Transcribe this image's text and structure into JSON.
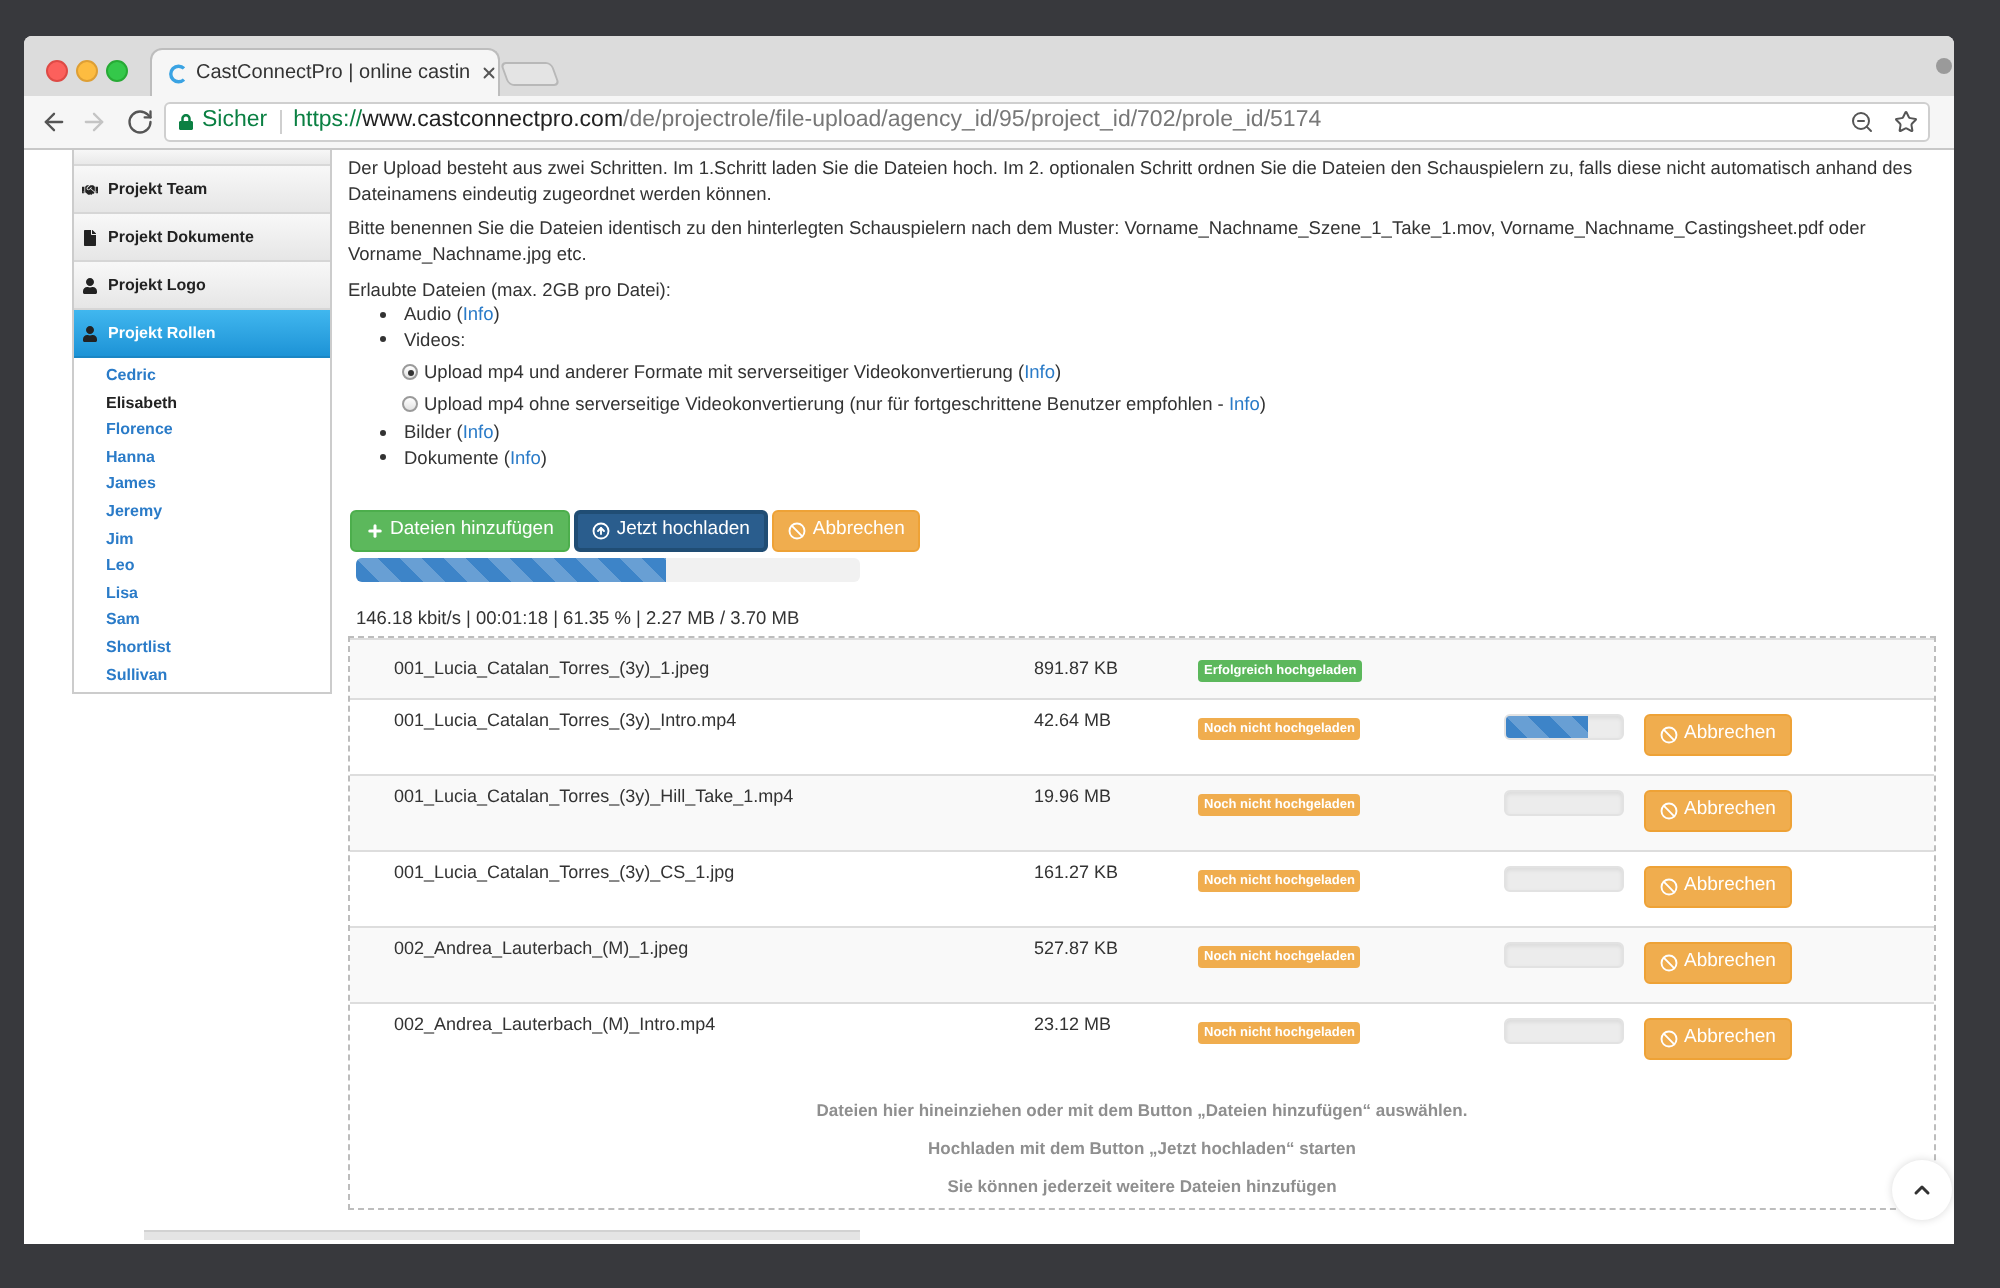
{
  "browser": {
    "tab": {
      "title": "CastConnectPro | online castin",
      "selected": true
    },
    "nav": [
      {
        "kind": "back",
        "disabled": false
      },
      {
        "kind": "forward",
        "disabled": true
      },
      {
        "kind": "reload",
        "disabled": false
      }
    ],
    "address": {
      "security": "Sicher",
      "scheme": "https://",
      "host": "www.castconnectpro.com",
      "path": "/de/projectrole/file-upload/agency_id/95/project_id/702/prole_id/5174"
    }
  },
  "sidebar": {
    "menu": [
      {
        "label": "Projekt Team",
        "selected": false
      },
      {
        "label": "Projekt Dokumente",
        "selected": false
      },
      {
        "label": "Projekt Logo",
        "selected": false
      },
      {
        "label": "Projekt Rollen",
        "selected": true
      }
    ],
    "roles": [
      {
        "label": "Cedric",
        "selected": false
      },
      {
        "label": "Elisabeth",
        "selected": true
      },
      {
        "label": "Florence",
        "selected": false
      },
      {
        "label": "Hanna",
        "selected": false
      },
      {
        "label": "James",
        "selected": false
      },
      {
        "label": "Jeremy",
        "selected": false
      },
      {
        "label": "Jim",
        "selected": false
      },
      {
        "label": "Leo",
        "selected": false
      },
      {
        "label": "Lisa",
        "selected": false
      },
      {
        "label": "Sam",
        "selected": false
      },
      {
        "label": "Shortlist",
        "selected": false
      },
      {
        "label": "Sullivan",
        "selected": false
      }
    ]
  },
  "intro": [
    "Der Upload besteht aus zwei Schritten. Im 1.Schritt laden Sie die Dateien hoch. Im 2. optionalen Schritt ordnen Sie die Dateien den Schauspielern zu, falls diese nicht automatisch anhand des Dateinamens eindeutig zugeordnet werden können.",
    "Bitte benennen Sie die Dateien identisch zu den hinterlegten Schauspielern nach dem Muster: Vorname_Nachname_Szene_1_Take_1.mov, Vorname_Nachname_Castingsheet.pdf oder Vorname_Nachname.jpg etc."
  ],
  "allowed_files": {
    "heading": "Erlaubte Dateien (max. 2GB pro Datei):",
    "items": [
      {
        "text": "Audio (",
        "link": "Info",
        "text_after": ")"
      },
      {
        "text": "Videos:",
        "options": [
          {
            "text": "Upload mp4 und anderer Formate mit serverseitiger Videokonvertierung (",
            "link": "Info",
            "text_after": ")",
            "selected": true
          },
          {
            "text": "Upload mp4 ohne serverseitige Videokonvertierung (nur für fortgeschrittene Benutzer empfohlen - ",
            "link": "Info",
            "text_after": ")",
            "selected": false
          }
        ]
      },
      {
        "text": "Bilder (",
        "link": "Info",
        "text_after": ")"
      },
      {
        "text": "Dokumente (",
        "link": "Info",
        "text_after": ")"
      }
    ]
  },
  "buttons": [
    {
      "label": "Dateien hinzufügen",
      "kind": "add",
      "focused": false
    },
    {
      "label": "Jetzt hochladen",
      "kind": "upload",
      "focused": true
    },
    {
      "label": "Abbrechen",
      "kind": "cancel",
      "focused": false
    }
  ],
  "upload_progress": {
    "level": 0.6135
  },
  "upload_stats": "146.18 kbit/s | 00:01:18 | 61.35 % | 2.27 MB / 3.70 MB",
  "files": [
    {
      "name": "001_Lucia_Catalan_Torres_(3y)_1.jpeg",
      "size": "891.87 KB",
      "status": {
        "label": "Erfolgreich hochgeladen",
        "kind": "success"
      }
    },
    {
      "name": "001_Lucia_Catalan_Torres_(3y)_Intro.mp4",
      "size": "42.64 MB",
      "status": {
        "label": "Noch nicht hochgeladen",
        "kind": "pending"
      },
      "level": 0.71,
      "cancel": "Abbrechen"
    },
    {
      "name": "001_Lucia_Catalan_Torres_(3y)_Hill_Take_1.mp4",
      "size": "19.96 MB",
      "status": {
        "label": "Noch nicht hochgeladen",
        "kind": "pending"
      },
      "cancel": "Abbrechen"
    },
    {
      "name": "001_Lucia_Catalan_Torres_(3y)_CS_1.jpg",
      "size": "161.27 KB",
      "status": {
        "label": "Noch nicht hochgeladen",
        "kind": "pending"
      },
      "cancel": "Abbrechen"
    },
    {
      "name": "002_Andrea_Lauterbach_(M)_1.jpeg",
      "size": "527.87 KB",
      "status": {
        "label": "Noch nicht hochgeladen",
        "kind": "pending"
      },
      "cancel": "Abbrechen"
    },
    {
      "name": "002_Andrea_Lauterbach_(M)_Intro.mp4",
      "size": "23.12 MB",
      "status": {
        "label": "Noch nicht hochgeladen",
        "kind": "pending"
      },
      "cancel": "Abbrechen"
    }
  ],
  "drop_hints": [
    "Dateien hier hineinziehen oder mit dem Button „Dateien hinzufügen“ auswählen.",
    "Hochladen mit dem Button „Jetzt hochladen“ starten",
    "Sie können jederzeit weitere Dateien hinzufügen"
  ]
}
